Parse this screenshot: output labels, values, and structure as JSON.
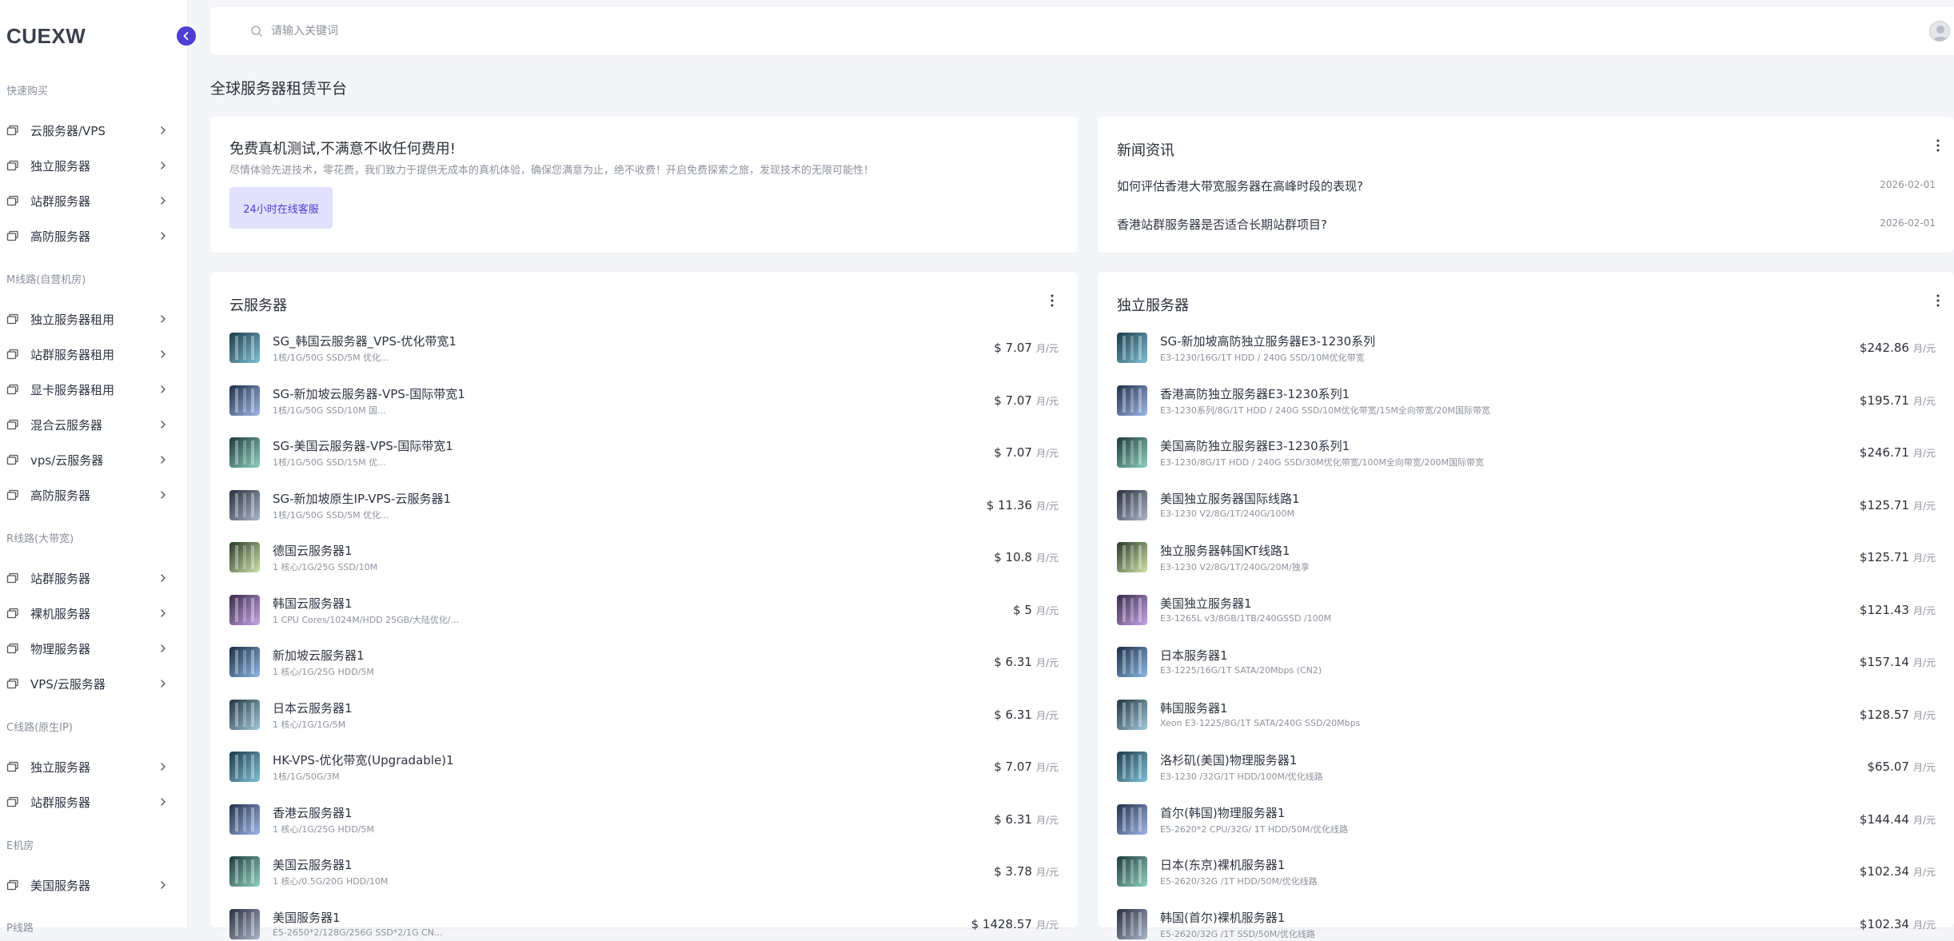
{
  "app": {
    "logo": "CUEXW"
  },
  "search": {
    "placeholder": "请输入关键词"
  },
  "page": {
    "title": "全球服务器租赁平台"
  },
  "sidebar": {
    "sections": [
      {
        "title": "快速购买",
        "items": [
          "云服务器/VPS",
          "独立服务器",
          "站群服务器",
          "高防服务器"
        ]
      },
      {
        "title": "M线路(自营机房)",
        "items": [
          "独立服务器租用",
          "站群服务器租用",
          "显卡服务器租用",
          "混合云服务器",
          "vps/云服务器",
          "高防服务器"
        ]
      },
      {
        "title": "R线路(大带宽)",
        "items": [
          "站群服务器",
          "裸机服务器",
          "物理服务器",
          "VPS/云服务器"
        ]
      },
      {
        "title": "C线路(原生IP)",
        "items": [
          "独立服务器",
          "站群服务器"
        ]
      },
      {
        "title": "E机房",
        "items": [
          "美国服务器"
        ]
      },
      {
        "title": "P线路",
        "items": []
      }
    ]
  },
  "promo": {
    "title": "免费真机测试,不满意不收任何费用!",
    "desc": "尽情体验先进技术，零花费，我们致力于提供无成本的真机体验，确保您满意为止，绝不收费！开启免费探索之旅，发现技术的无限可能性！",
    "button": "24小时在线客服"
  },
  "news": {
    "title": "新闻资讯",
    "items": [
      {
        "title": "如何评估香港大带宽服务器在高峰时段的表现?",
        "date": "2026-02-01"
      },
      {
        "title": "香港站群服务器是否适合长期站群项目?",
        "date": "2026-02-01"
      }
    ]
  },
  "cloud": {
    "title": "云服务器",
    "items": [
      {
        "name": "SG_韩国云服务器_VPS-优化带宽1",
        "spec": "1核/1G/50G SSD/5M 优化...",
        "price": "$ 7.07",
        "unit": "月/元"
      },
      {
        "name": "SG-新加坡云服务器-VPS-国际带宽1",
        "spec": "1核/1G/50G SSD/10M 国...",
        "price": "$ 7.07",
        "unit": "月/元"
      },
      {
        "name": "SG-美国云服务器-VPS-国际带宽1",
        "spec": "1核/1G/50G SSD/15M 优...",
        "price": "$ 7.07",
        "unit": "月/元"
      },
      {
        "name": "SG-新加坡原生IP-VPS-云服务器1",
        "spec": "1核/1G/50G SSD/5M 优化...",
        "price": "$ 11.36",
        "unit": "月/元"
      },
      {
        "name": "德国云服务器1",
        "spec": "1 核心/1G/25G SSD/10M",
        "price": "$ 10.8",
        "unit": "月/元"
      },
      {
        "name": "韩国云服务器1",
        "spec": "1 CPU Cores/1024M/HDD 25GB/大陆优化/...",
        "price": "$ 5",
        "unit": "月/元"
      },
      {
        "name": "新加坡云服务器1",
        "spec": "1 核心/1G/25G HDD/5M",
        "price": "$ 6.31",
        "unit": "月/元"
      },
      {
        "name": "日本云服务器1",
        "spec": "1 核心/1G/1G/5M",
        "price": "$ 6.31",
        "unit": "月/元"
      },
      {
        "name": "HK-VPS-优化带宽(Upgradable)1",
        "spec": "1核/1G/50G/3M",
        "price": "$ 7.07",
        "unit": "月/元"
      },
      {
        "name": "香港云服务器1",
        "spec": "1 核心/1G/25G HDD/5M",
        "price": "$ 6.31",
        "unit": "月/元"
      },
      {
        "name": "美国云服务器1",
        "spec": "1 核心/0.5G/20G HDD/10M",
        "price": "$ 3.78",
        "unit": "月/元"
      },
      {
        "name": "美国服务器1",
        "spec": "E5-2650*2/128G/256G SSD*2/1G CN...",
        "price": "$ 1428.57",
        "unit": "月/元"
      }
    ]
  },
  "dedicated": {
    "title": "独立服务器",
    "items": [
      {
        "name": "SG-新加坡高防独立服务器E3-1230系列",
        "spec": "E3-1230/16G/1T HDD / 240G SSD/10M优化带宽",
        "price": "$242.86",
        "unit": "月/元"
      },
      {
        "name": "香港高防独立服务器E3-1230系列1",
        "spec": "E3-1230系列/8G/1T HDD / 240G SSD/10M优化带宽/15M全向带宽/20M国际带宽",
        "price": "$195.71",
        "unit": "月/元"
      },
      {
        "name": "美国高防独立服务器E3-1230系列1",
        "spec": "E3-1230/8G/1T HDD / 240G SSD/30M优化带宽/100M全向带宽/200M国际带宽",
        "price": "$246.71",
        "unit": "月/元"
      },
      {
        "name": "美国独立服务器国际线路1",
        "spec": "E3-1230 V2/8G/1T/240G/100M",
        "price": "$125.71",
        "unit": "月/元"
      },
      {
        "name": "独立服务器韩国KT线路1",
        "spec": "E3-1230 V2/8G/1T/240G/20M/独享",
        "price": "$125.71",
        "unit": "月/元"
      },
      {
        "name": "美国独立服务器1",
        "spec": "E3-1265L v3/8GB/1TB/240GSSD /100M",
        "price": "$121.43",
        "unit": "月/元"
      },
      {
        "name": "日本服务器1",
        "spec": "E3-1225/16G/1T SATA/20Mbps (CN2)",
        "price": "$157.14",
        "unit": "月/元"
      },
      {
        "name": "韩国服务器1",
        "spec": "Xeon E3-1225/8G/1T SATA/240G SSD/20Mbps",
        "price": "$128.57",
        "unit": "月/元"
      },
      {
        "name": "洛杉矶(美国)物理服务器1",
        "spec": "E3-1230 /32G/1T HDD/100M/优化线路",
        "price": "$65.07",
        "unit": "月/元"
      },
      {
        "name": "首尔(韩国)物理服务器1",
        "spec": "E5-2620*2 CPU/32G/ 1T HDD/50M/优化线路",
        "price": "$144.44",
        "unit": "月/元"
      },
      {
        "name": "日本(东京)裸机服务器1",
        "spec": "E5-2620/32G /1T HDD/50M/优化线路",
        "price": "$102.34",
        "unit": "月/元"
      },
      {
        "name": "韩国(首尔)裸机服务器1",
        "spec": "E5-2620/32G /1T SSD/50M/优化线路",
        "price": "$102.34",
        "unit": "月/元"
      }
    ]
  },
  "colors": {
    "accent": "#4d3fd2",
    "accent_light": "#e1e1fb",
    "bg": "#f4f5f8",
    "muted": "#8d929c"
  },
  "icons": {
    "server": "server-icon",
    "chevron": "chevron-right-icon",
    "search": "search-icon",
    "more": "more-vertical-icon",
    "collapse": "chevron-left-icon",
    "avatar": "user-avatar-icon"
  }
}
